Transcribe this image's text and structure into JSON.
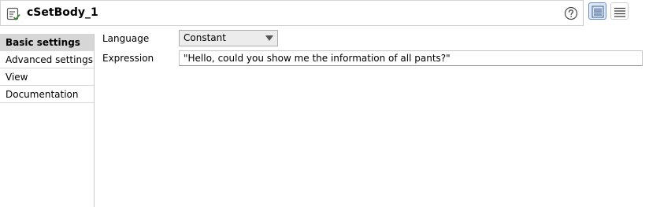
{
  "header": {
    "title": "cSetBody_1",
    "component_icon": "component-check-icon",
    "help_icon": "help-icon",
    "view_toggles": [
      {
        "icon": "list-view-icon",
        "active": true
      },
      {
        "icon": "menu-lines-icon",
        "active": false
      }
    ]
  },
  "sidebar": {
    "items": [
      {
        "label": "Basic settings",
        "selected": true
      },
      {
        "label": "Advanced settings",
        "selected": false
      },
      {
        "label": "View",
        "selected": false
      },
      {
        "label": "Documentation",
        "selected": false
      }
    ]
  },
  "form": {
    "language": {
      "label": "Language",
      "value": "Constant"
    },
    "expression": {
      "label": "Expression",
      "value": "\"Hello, could you show me the information of all pants?\""
    }
  },
  "colors": {
    "selected_nav_bg": "#d6d6d6",
    "active_toggle_bg": "#dbe7f6",
    "active_toggle_border": "#6a8fc0",
    "icon_green": "#3a8a3a"
  }
}
